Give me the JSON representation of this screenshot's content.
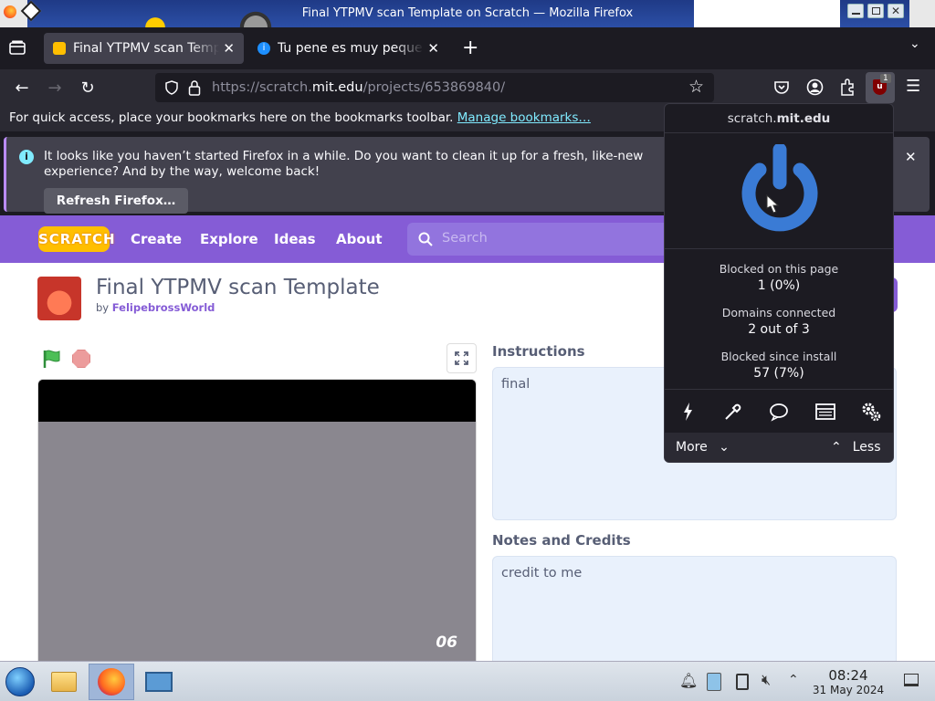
{
  "window": {
    "title": "Final YTPMV scan Template on Scratch — Mozilla Firefox"
  },
  "tabs": [
    {
      "label": "Final YTPMV scan Template",
      "active": true
    },
    {
      "label": "Tu pene es muy pequeño",
      "active": false
    }
  ],
  "urlbar": {
    "prefix": "https://scratch.",
    "domain": "mit.edu",
    "path": "/projects/653869840/"
  },
  "bookmarks_bar": {
    "message": "For quick access, place your bookmarks here on the bookmarks toolbar.",
    "link": "Manage bookmarks…"
  },
  "notification": {
    "message": "It looks like you haven’t started Firefox in a while. Do you want to clean it up for a fresh, like-new experience? And by the way, welcome back!",
    "button": "Refresh Firefox…"
  },
  "scratch": {
    "logo": "SCRATCH",
    "nav": [
      "Create",
      "Explore",
      "Ideas",
      "About"
    ],
    "search_placeholder": "Search",
    "project_title": "Final YTPMV scan Template",
    "by_prefix": "by",
    "author": "FelipebrossWorld",
    "stage_number": "06",
    "instructions_heading": "Instructions",
    "instructions_text": "final",
    "notes_heading": "Notes and Credits",
    "notes_text": "credit to me"
  },
  "ublock": {
    "domain_prefix": "scratch.",
    "domain_main": "mit.edu",
    "blocked_page_label": "Blocked on this page",
    "blocked_page_value": "1 (0%)",
    "domains_label": "Domains connected",
    "domains_value": "2 out of 3",
    "blocked_install_label": "Blocked since install",
    "blocked_install_value": "57 (7%)",
    "more_label": "More",
    "less_label": "Less",
    "badge_count": "1"
  },
  "taskbar": {
    "time": "08:24",
    "date": "31 May 2024"
  }
}
